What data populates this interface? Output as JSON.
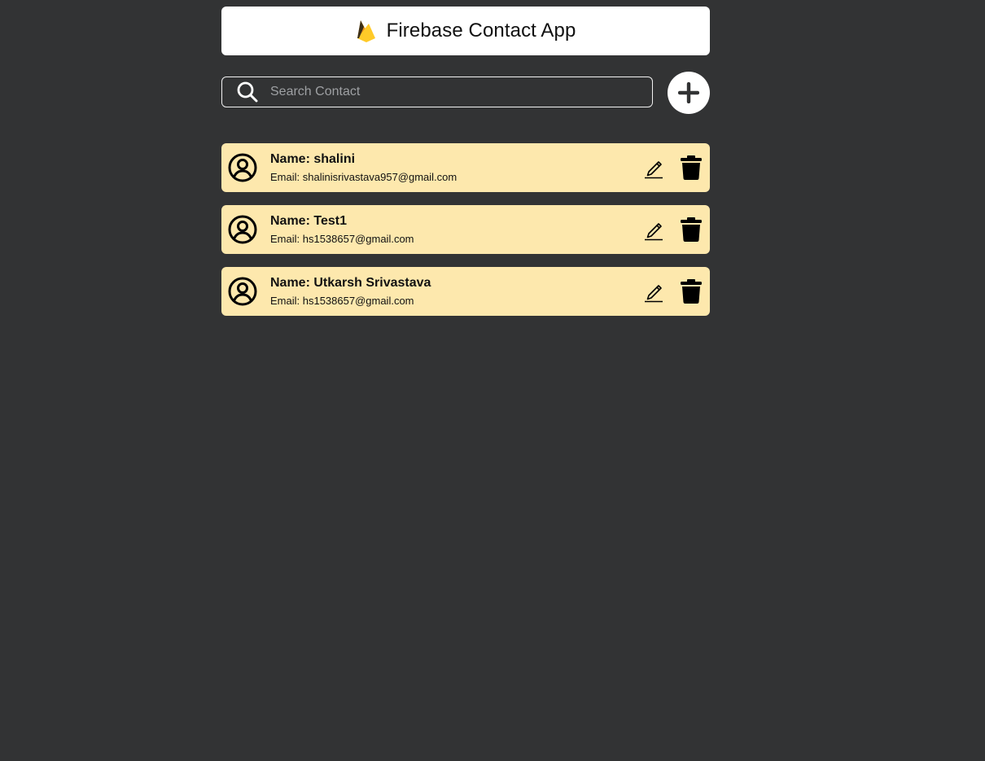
{
  "header": {
    "title": "Firebase Contact App",
    "logo_icon": "firebase-logo"
  },
  "search": {
    "placeholder": "Search Contact",
    "value": "",
    "icon": "search-icon"
  },
  "add_button": {
    "icon": "plus-icon"
  },
  "contacts": [
    {
      "name": "Name: shalini",
      "email": "Email: shalinisrivastava957@gmail.com"
    },
    {
      "name": "Name: Test1",
      "email": "Email: hs1538657@gmail.com"
    },
    {
      "name": "Name: Utkarsh Srivastava",
      "email": "Email: hs1538657@gmail.com"
    }
  ],
  "colors": {
    "background": "#323334",
    "card": "#fde8ad",
    "header": "#ffffff",
    "text": "#111111",
    "placeholder": "#9ea0a3"
  }
}
